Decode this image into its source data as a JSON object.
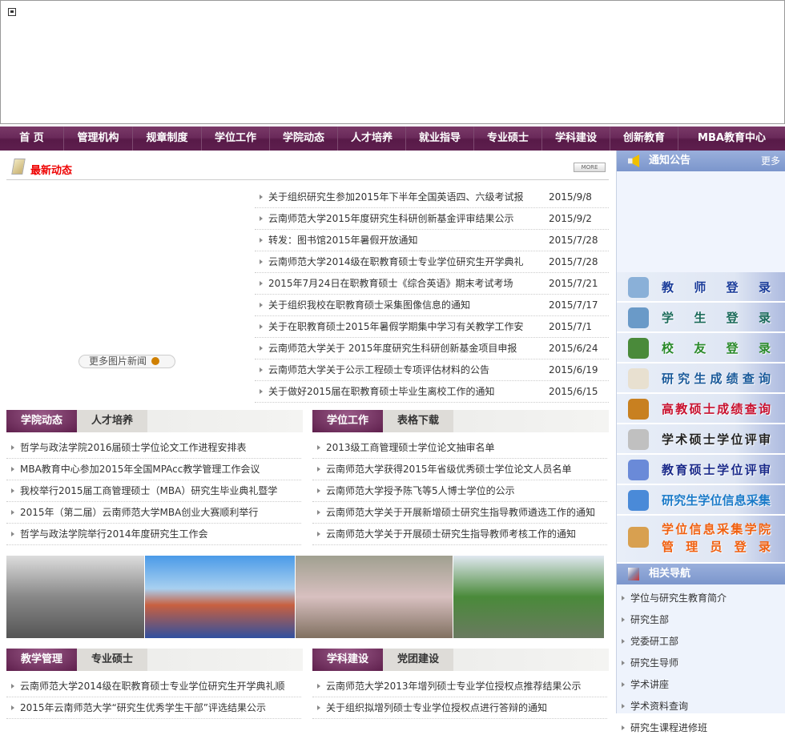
{
  "banner": {
    "icon": "broken-image-icon"
  },
  "nav": [
    "首 页",
    "管理机构",
    "规章制度",
    "学位工作",
    "学院动态",
    "人才培养",
    "就业指导",
    "专业硕士",
    "学科建设",
    "创新教育",
    "MBA教育中心"
  ],
  "latest": {
    "title": "最新动态",
    "more": "MORE",
    "pic_more": "更多图片新闻",
    "items": [
      {
        "t": "关于组织研究生参加2015年下半年全国英语四、六级考试报",
        "d": "2015/9/8"
      },
      {
        "t": "云南师范大学2015年度研究生科研创新基金评审结果公示",
        "d": "2015/9/2"
      },
      {
        "t": "转发：图书馆2015年暑假开放通知",
        "d": "2015/7/28"
      },
      {
        "t": "云南师范大学2014级在职教育硕士专业学位研究生开学典礼",
        "d": "2015/7/28"
      },
      {
        "t": "2015年7月24日在职教育硕士《综合英语》期末考试考场",
        "d": "2015/7/21"
      },
      {
        "t": "关于组织我校在职教育硕士采集图像信息的通知",
        "d": "2015/7/17"
      },
      {
        "t": "关于在职教育硕士2015年暑假学期集中学习有关教学工作安",
        "d": "2015/7/1"
      },
      {
        "t": "云南师范大学关于 2015年度研究生科研创新基金项目申报",
        "d": "2015/6/24"
      },
      {
        "t": "云南师范大学关于公示工程硕士专项评估材料的公告",
        "d": "2015/6/19"
      },
      {
        "t": "关于做好2015届在职教育硕士毕业生离校工作的通知",
        "d": "2015/6/15"
      }
    ]
  },
  "box1": {
    "tabs": [
      "学院动态",
      "人才培养"
    ],
    "items": [
      "哲学与政法学院2016届硕士学位论文工作进程安排表",
      "MBA教育中心参加2015年全国MPAcc教学管理工作会议",
      "我校举行2015届工商管理硕士（MBA）研究生毕业典礼暨学",
      "2015年（第二届）云南师范大学MBA创业大赛顺利举行",
      "哲学与政法学院举行2014年度研究生工作会"
    ]
  },
  "box2": {
    "tabs": [
      "学位工作",
      "表格下载"
    ],
    "items": [
      "2013级工商管理硕士学位论文抽审名单",
      "云南师范大学获得2015年省级优秀硕士学位论文人员名单",
      "云南师范大学授予陈飞等5人博士学位的公示",
      "云南师范大学关于开展新增硕士研究生指导教师遴选工作的通知",
      "云南师范大学关于开展硕士研究生指导教师考核工作的通知"
    ]
  },
  "box3": {
    "tabs": [
      "教学管理",
      "专业硕士"
    ],
    "items": [
      "云南师范大学2014级在职教育硕士专业学位研究生开学典礼顺",
      "2015年云南师范大学“研究生优秀学生干部”评选结果公示"
    ]
  },
  "box4": {
    "tabs": [
      "学科建设",
      "党团建设"
    ],
    "items": [
      "云南师范大学2013年增列硕士专业学位授权点推荐结果公示",
      "关于组织拟增列硕士专业学位授权点进行答辩的通知"
    ]
  },
  "notice": {
    "title": "通知公告",
    "more": "更多"
  },
  "buttons": [
    {
      "label": "教师登录",
      "color": "#1a3c9a",
      "icon": "monitor-icon"
    },
    {
      "label": "学生登录",
      "color": "#1a6a5a",
      "icon": "users-icon"
    },
    {
      "label": "校友登录",
      "color": "#2a8a2a",
      "icon": "alumni-icon"
    },
    {
      "label": "研究生成绩查询",
      "color": "#1a5a9a",
      "icon": "notepad-icon"
    },
    {
      "label": "高教硕士成绩查询",
      "color": "#c8102e",
      "icon": "book-icon"
    },
    {
      "label": "学术硕士学位评审",
      "color": "#222222",
      "icon": "pen-icon"
    },
    {
      "label": "教育硕士学位评审",
      "color": "#1a2a8a",
      "icon": "edit-icon"
    },
    {
      "label": "研究生学位信息采集",
      "color": "#1a7ac8",
      "icon": "laptop-icon"
    },
    {
      "label": "学位信息采集学院",
      "label2": "管理员登录",
      "color": "#f06010",
      "icon": "admin-icon"
    }
  ],
  "related": {
    "title": "相关导航",
    "items": [
      "学位与研究生教育简介",
      "研究生部",
      "党委研工部",
      "研究生导师",
      "学术讲座",
      "学术资料查询",
      "研究生课程进修班"
    ]
  }
}
